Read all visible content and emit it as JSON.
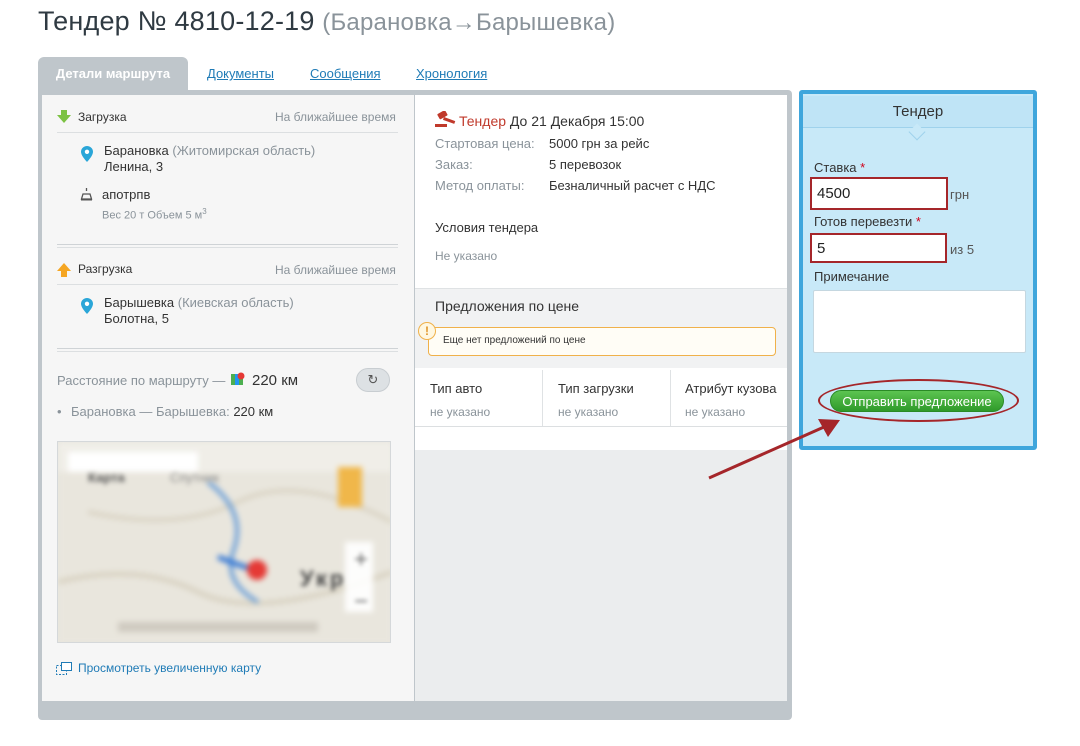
{
  "page": {
    "title": "Тендер № 4810-12-19",
    "route": "(Барановка→Барышевка)"
  },
  "tabs": {
    "active": "Детали маршрута",
    "documents": "Документы",
    "messages": "Сообщения",
    "chronology": "Хронология"
  },
  "loading": {
    "label": "Загрузка",
    "time": "На ближайшее время",
    "city": "Барановка",
    "region": "(Житомирская область)",
    "street": "Ленина, 3",
    "cargo_name": "апотрпв",
    "cargo_details": "Вес 20 т  Объем 5 м",
    "cargo_sup": "3"
  },
  "unloading": {
    "label": "Разгрузка",
    "time": "На ближайшее время",
    "city": "Барышевка",
    "region": "(Киевская область)",
    "street": "Болотна, 5"
  },
  "distance": {
    "label": "Расстояние по маршруту —",
    "value": "220 км",
    "segment_label": "Барановка — Барышевка:",
    "segment_value": "220 км",
    "refresh_icon": "↻"
  },
  "map": {
    "tab_map": "Карта",
    "tab_satellite": "Спутник",
    "country_text": "Укр",
    "zoom_in": "+",
    "zoom_out": "−",
    "enlarge_link": "Просмотреть увеличенную карту"
  },
  "tender_info": {
    "label": "Тендер",
    "deadline": "До 21 Декабря 15:00",
    "rows": [
      {
        "key": "Стартовая цена:",
        "value": "5000 грн за рейс"
      },
      {
        "key": "Заказ:",
        "value": "5 перевозок"
      },
      {
        "key": "Метод оплаты:",
        "value": "Безналичный расчет с НДС"
      }
    ],
    "conditions_title": "Условия тендера",
    "conditions_value": "Не указано"
  },
  "proposals": {
    "title": "Предложения по цене",
    "warning": "Еще нет предложений по цене",
    "warning_icon": "!"
  },
  "vehicle_table": {
    "headers": [
      "Тип авто",
      "Тип загрузки",
      "Атрибут кузова"
    ],
    "values": [
      "не указано",
      "не указано",
      "не указано"
    ]
  },
  "tender_form": {
    "title": "Тендер",
    "rate_label": "Ставка",
    "required_mark": "*",
    "rate_value": "4500",
    "rate_unit": "грн",
    "ready_label": "Готов перевезти",
    "ready_value": "5",
    "ready_suffix": "из 5",
    "note_label": "Примечание",
    "note_value": "",
    "submit_label": "Отправить предложение"
  },
  "colors": {
    "panel_border": "#3fa6dc",
    "highlight": "#a5262a",
    "button_green": "#2f9a2a",
    "link": "#1f7bb6"
  }
}
